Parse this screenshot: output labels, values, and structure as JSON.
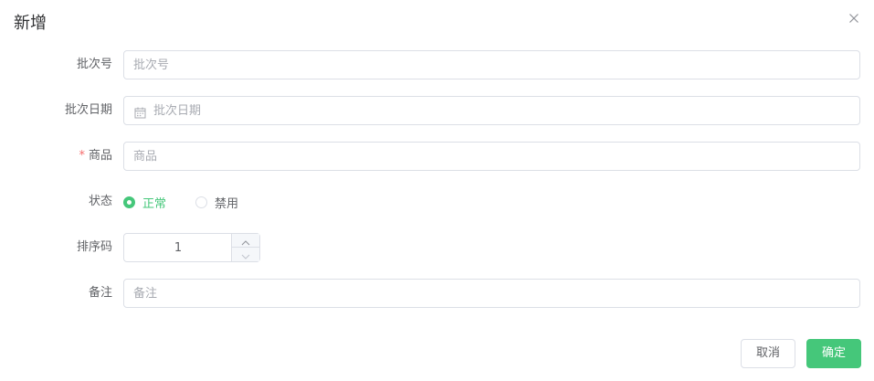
{
  "dialog": {
    "title": "新增",
    "close_icon": "close-icon"
  },
  "form": {
    "batch_no": {
      "label": "批次号",
      "placeholder": "批次号",
      "value": ""
    },
    "batch_date": {
      "label": "批次日期",
      "placeholder": "批次日期",
      "value": "",
      "icon": "calendar-icon"
    },
    "product": {
      "label": "商品",
      "required": true,
      "required_mark": "*",
      "placeholder": "商品",
      "value": ""
    },
    "status": {
      "label": "状态",
      "options": [
        {
          "label": "正常",
          "checked": true
        },
        {
          "label": "禁用",
          "checked": false
        }
      ]
    },
    "sort_code": {
      "label": "排序码",
      "value": "1",
      "increase_icon": "chevron-up-icon",
      "decrease_icon": "chevron-down-icon"
    },
    "remark": {
      "label": "备注",
      "placeholder": "备注",
      "value": ""
    }
  },
  "footer": {
    "cancel_label": "取消",
    "confirm_label": "确定"
  },
  "colors": {
    "primary": "#45c77a",
    "required": "#f56c6c",
    "border": "#dcdfe6",
    "text": "#606266",
    "placeholder": "#a8abb2",
    "title": "#303133"
  }
}
